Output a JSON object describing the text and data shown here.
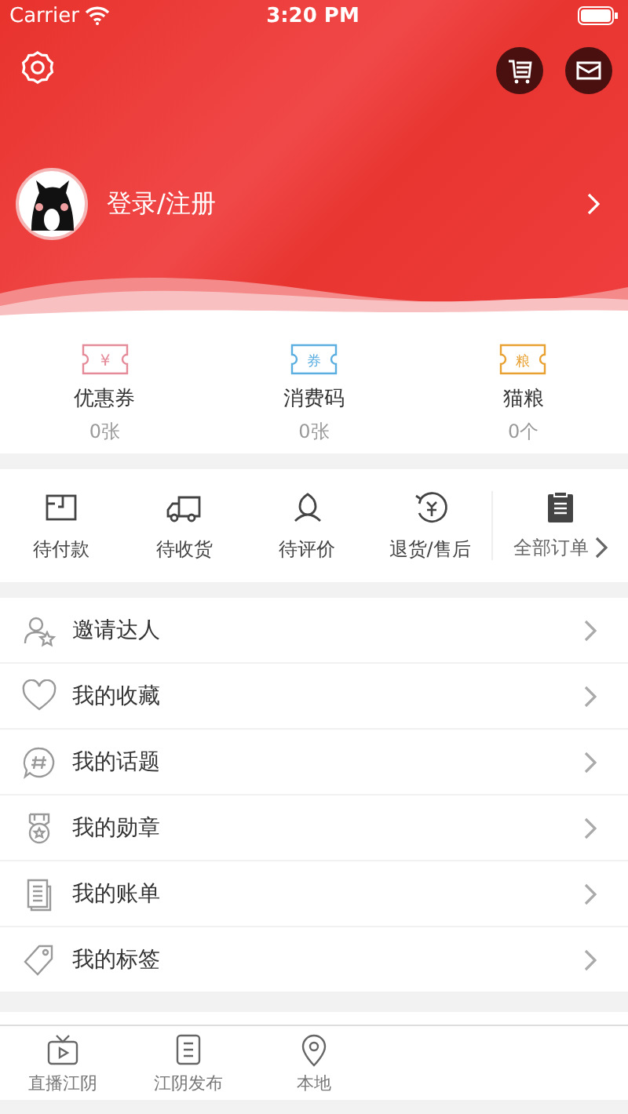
{
  "status_bar": {
    "carrier": "Carrier",
    "time": "3:20 PM"
  },
  "header": {
    "actions": [
      {
        "kind": "settings"
      },
      {
        "kind": "cart"
      },
      {
        "kind": "mail"
      }
    ],
    "login_label": "登录/注册"
  },
  "assets": [
    {
      "kind": "coupon",
      "icon_text": "¥",
      "color": "#e48a98",
      "label": "优惠券",
      "value": "0张"
    },
    {
      "kind": "code",
      "icon_text": "券",
      "color": "#5aaee0",
      "label": "消费码",
      "value": "0张"
    },
    {
      "kind": "food",
      "icon_text": "粮",
      "color": "#e8a030",
      "label": "猫粮",
      "value": "0个"
    }
  ],
  "orders": [
    {
      "kind": "pay",
      "label": "待付款"
    },
    {
      "kind": "ship",
      "label": "待收货"
    },
    {
      "kind": "review",
      "label": "待评价"
    },
    {
      "kind": "refund",
      "label": "退货/售后"
    }
  ],
  "all_orders": "全部订单",
  "menu": [
    {
      "kind": "invite",
      "label": "邀请达人"
    },
    {
      "kind": "favorite",
      "label": "我的收藏"
    },
    {
      "kind": "topic",
      "label": "我的话题"
    },
    {
      "kind": "medal",
      "label": "我的勋章"
    },
    {
      "kind": "bill",
      "label": "我的账单"
    },
    {
      "kind": "tag",
      "label": "我的标签"
    }
  ],
  "tab_bar": [
    {
      "kind": "live",
      "label": "直播江阴"
    },
    {
      "kind": "news",
      "label": "江阴发布"
    },
    {
      "kind": "local",
      "label": "本地"
    }
  ]
}
